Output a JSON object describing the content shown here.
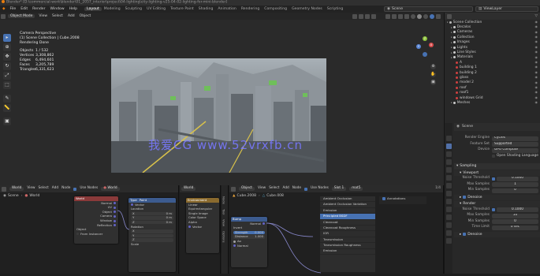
{
  "titlebar": {
    "text": "Blender* [D:\\commercial-work\\blender\\01_2057_interior\\project\\04-lighting\\city-lighting-v25-04-02-lighting-for-mini-blender]"
  },
  "menu": [
    "File",
    "Edit",
    "Render",
    "Window",
    "Help"
  ],
  "workspaces": [
    {
      "label": "Layout",
      "active": true
    },
    {
      "label": "Modeling",
      "active": false
    },
    {
      "label": "Sculpting",
      "active": false
    },
    {
      "label": "UV Editing",
      "active": false
    },
    {
      "label": "Texture Paint",
      "active": false
    },
    {
      "label": "Shading",
      "active": false
    },
    {
      "label": "Animation",
      "active": false
    },
    {
      "label": "Rendering",
      "active": false
    },
    {
      "label": "Compositing",
      "active": false
    },
    {
      "label": "Geometry Nodes",
      "active": false
    },
    {
      "label": "Scripting",
      "active": false
    }
  ],
  "scene_field": "Scene",
  "viewlayer_field": "ViewLayer",
  "viewport": {
    "mode": "Object Mode",
    "menus": [
      "View",
      "Select",
      "Add",
      "Object"
    ],
    "overlay": {
      "line1": "Camera Perspective",
      "line2": "(1) Scene Collection | Cube.2008",
      "line3": "Rendering Done",
      "stats": [
        {
          "k": "Objects",
          "v": "1 / 532"
        },
        {
          "k": "Vertices",
          "v": "3,308,862"
        },
        {
          "k": "Edges",
          "v": "6,494,601"
        },
        {
          "k": "Faces",
          "v": "3,205,789"
        },
        {
          "k": "Triangles",
          "v": "6,331,623"
        }
      ]
    },
    "gizmo": {
      "x": "X",
      "y": "Y",
      "z": "Z"
    },
    "watermark": "我爱CG  www.52vrxfb.cn"
  },
  "outliner": {
    "title": "Scene Collection",
    "items": [
      {
        "label": "Scene Collection",
        "depth": 0,
        "color": "#bbbbbb"
      },
      {
        "label": "Decalos",
        "depth": 1,
        "color": "#cccccc"
      },
      {
        "label": "Cameras",
        "depth": 1,
        "color": "#cccccc"
      },
      {
        "label": "Collection",
        "depth": 1,
        "color": "#cccccc"
      },
      {
        "label": "Images",
        "depth": 1,
        "color": "#cccccc"
      },
      {
        "label": "Lights",
        "depth": 1,
        "color": "#cccccc"
      },
      {
        "label": "Line Styles",
        "depth": 1,
        "color": "#cccccc"
      },
      {
        "label": "Materials",
        "depth": 1,
        "color": "#cccccc"
      },
      {
        "label": "A",
        "depth": 2,
        "color": "#d04040"
      },
      {
        "label": "building 1",
        "depth": 2,
        "color": "#d04040"
      },
      {
        "label": "building 2",
        "depth": 2,
        "color": "#d04040"
      },
      {
        "label": "glass",
        "depth": 2,
        "color": "#d04040"
      },
      {
        "label": "model 2",
        "depth": 2,
        "color": "#d04040"
      },
      {
        "label": "roof",
        "depth": 2,
        "color": "#d04040"
      },
      {
        "label": "roof1",
        "depth": 2,
        "color": "#d04040"
      },
      {
        "label": "windows Grid",
        "depth": 2,
        "color": "#d04040"
      },
      {
        "label": "Meshes",
        "depth": 1,
        "color": "#cccccc"
      }
    ]
  },
  "properties": {
    "header": "Scene",
    "render_engine": {
      "label": "Render Engine",
      "value": "Cycles"
    },
    "feature_set": {
      "label": "Feature Set",
      "value": "Supported"
    },
    "device": {
      "label": "Device",
      "value": "GPU Compute"
    },
    "open_shading": "Open Shading Language",
    "sampling": "Sampling",
    "viewport": "Viewport",
    "noise_threshold_vp": {
      "label": "Noise Threshold",
      "value": "0.1000"
    },
    "max_samples_vp": {
      "label": "Max Samples",
      "value": "1"
    },
    "min_samples_vp": {
      "label": "Min Samples",
      "value": "0"
    },
    "denoise_vp": "Denoise",
    "render": "Render",
    "noise_threshold": {
      "label": "Noise Threshold",
      "value": "0.1000"
    },
    "max_samples": {
      "label": "Max Samples",
      "value": "10"
    },
    "min_samples": {
      "label": "Min Samples",
      "value": "0"
    },
    "time_limit": {
      "label": "Time Limit",
      "value": "0 sec"
    },
    "denoise": "Denoise"
  },
  "world_editor": {
    "menus": [
      "View",
      "Select",
      "Add",
      "Node"
    ],
    "type": "World",
    "use_nodes": "Use Nodes",
    "breadcrumb": [
      "Scene",
      "World"
    ],
    "node_world": {
      "title": "World",
      "outputs": [
        "Normal",
        "UV",
        "Object",
        "Camera",
        "Window",
        "Reflection"
      ],
      "object_label": "Object",
      "from_instancer": "From Instancer"
    },
    "node_vector": {
      "title": "Vector",
      "type_label": "Type",
      "type_value": "Point",
      "vector": "Vector",
      "location": "Location",
      "x": "0 m",
      "y": "0 m",
      "z": "0 m",
      "rotation": "Rotation",
      "rx": "X",
      "ry": "Y",
      "rz": "Z",
      "scale": "Scale"
    }
  },
  "env_editor": {
    "world_field": "World",
    "node_env": {
      "title": "Environment",
      "rows": [
        "Linear",
        "Equirectangular",
        "Single Image",
        "Color Space",
        "Alpha",
        "Vector"
      ]
    }
  },
  "object_editor": {
    "menus": [
      "View",
      "Select",
      "Add",
      "Node"
    ],
    "type": "Object",
    "object_name": "Cube.2008",
    "material_name": "Cube.008",
    "use_nodes": "Use Nodes",
    "slot": "Slot 1",
    "mat_field": "mat5",
    "node_mix": {
      "title": "Bump",
      "rows": [
        "Normal",
        "Invert",
        "Strength",
        "Distance"
      ],
      "vals": [
        "",
        "",
        "0.000",
        "1.000"
      ],
      "lower": [
        "Ao",
        "Normal"
      ]
    },
    "node_list": [
      "Ambient Occlusion",
      "Ambient Occlusion Variation",
      "Emission",
      "Principled BSDF",
      "Clearcoat",
      "Clearcoat Roughness",
      "IOR",
      "Transmission",
      "Transmission Roughness",
      "Emission"
    ],
    "node_list_selected": 3,
    "annotations": "Annotations",
    "breadcrumb_obj": "Cube.008",
    "nbar_tabs": [
      "Node",
      "Tool",
      "View",
      "Options"
    ],
    "slot_counter": "1/4"
  }
}
